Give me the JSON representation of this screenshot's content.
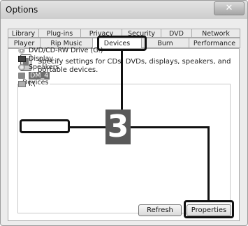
{
  "window": {
    "title": "Options",
    "close_glyph": "✕"
  },
  "tabs_back": [
    "Library",
    "Plug-ins",
    "Privacy",
    "Security",
    "DVD",
    "Network"
  ],
  "tabs_front": [
    "Player",
    "Rip Music",
    "Devices",
    "Burn",
    "Performance"
  ],
  "active_tab": "Devices",
  "description": "Specify settings for CDs, DVDs, displays, speakers, and portable devices.",
  "devices_group_label": "Devices",
  "devices": [
    {
      "label": "DVD/CD-RW Drive (G:)",
      "icon": "disc-drive-icon"
    },
    {
      "label": "Display",
      "icon": "monitor-icon"
    },
    {
      "label": "Speakers",
      "icon": "speaker-icon"
    },
    {
      "label": "DM_4",
      "icon": "portable-device-icon",
      "selected": true
    },
    {
      "label": "I:\\",
      "icon": "usb-drive-icon"
    }
  ],
  "buttons": {
    "refresh": "Refresh",
    "properties": "Properties"
  },
  "callout": {
    "step_number": "3",
    "color": "#111111"
  }
}
